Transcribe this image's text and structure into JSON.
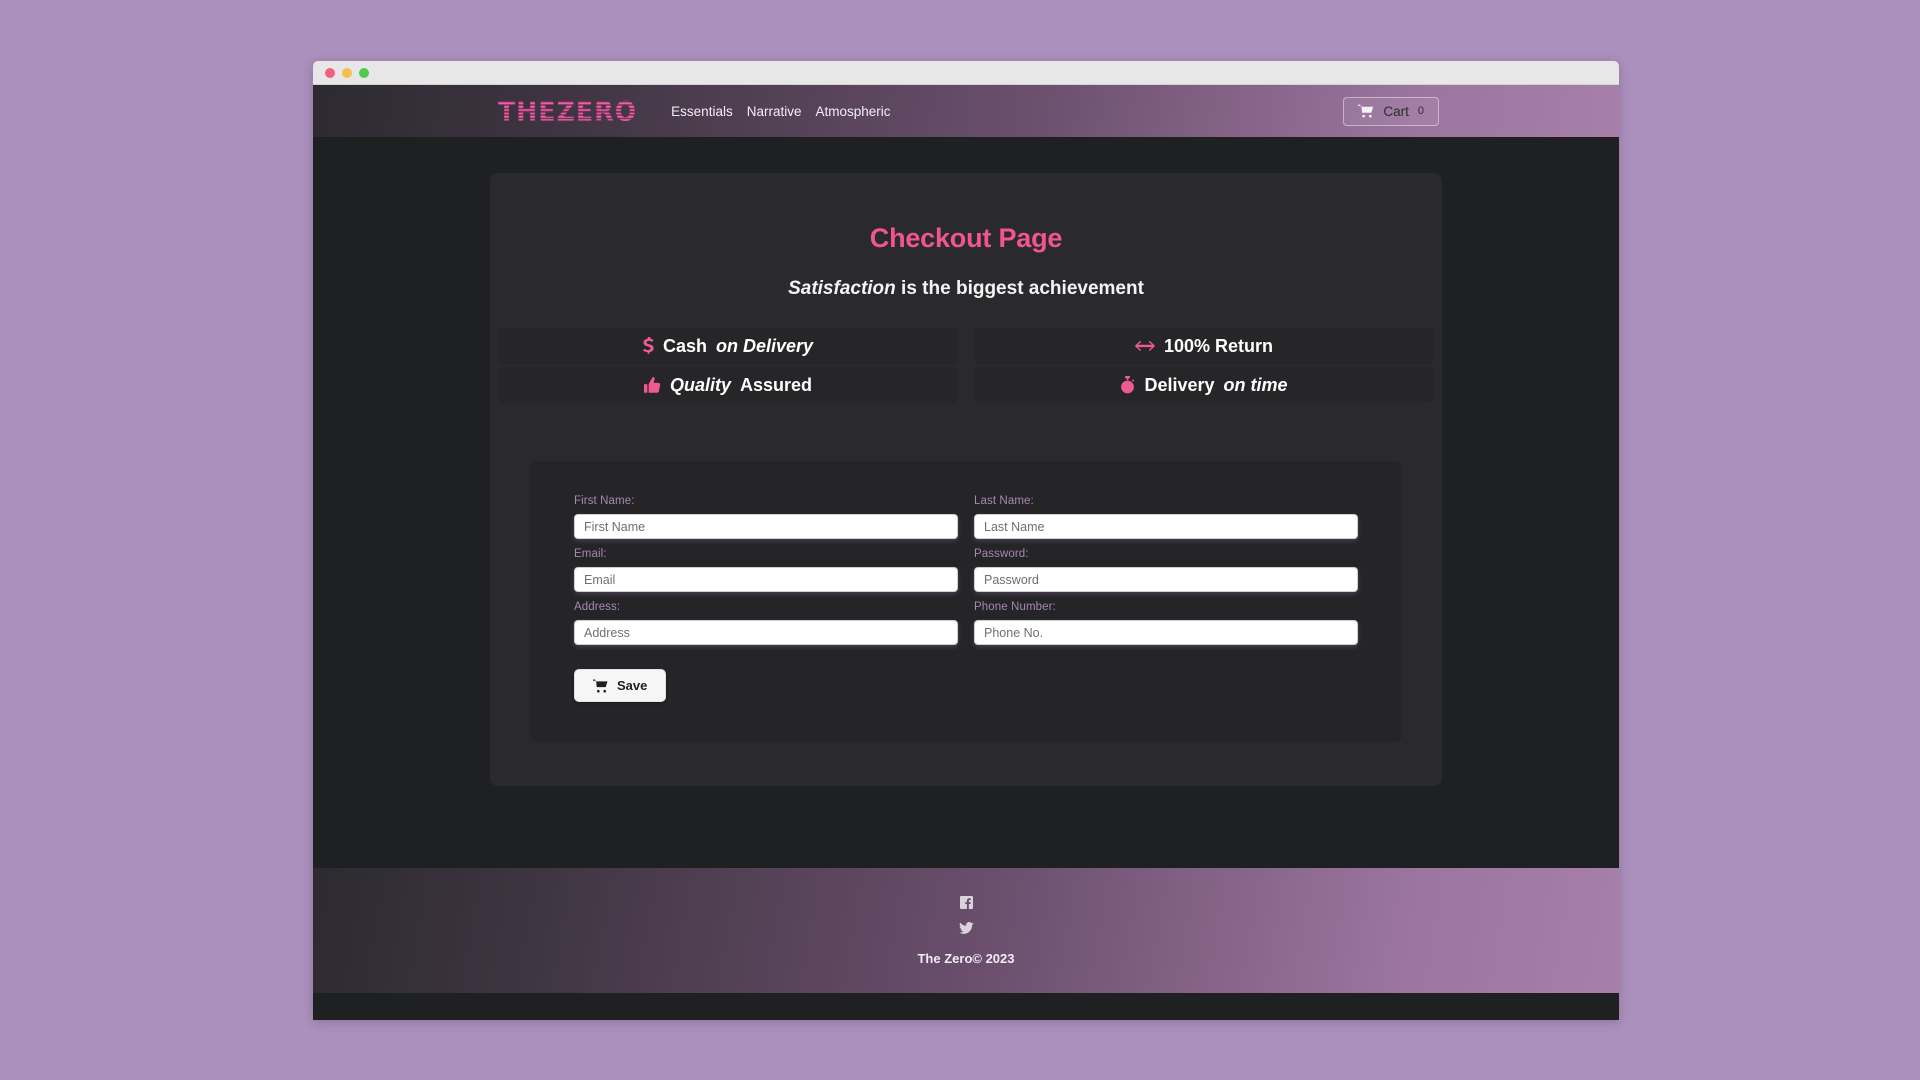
{
  "window": {
    "traffic_lights": [
      "close",
      "minimize",
      "maximize"
    ]
  },
  "navbar": {
    "brand": "THEZERO",
    "links": [
      {
        "label": "Essentials"
      },
      {
        "label": "Narrative"
      },
      {
        "label": "Atmospheric"
      }
    ],
    "cart": {
      "icon": "shopping-cart-icon",
      "label": "Cart",
      "count": "0"
    }
  },
  "main": {
    "title": "Checkout Page",
    "subtitle_emphasis": "Satisfaction",
    "subtitle_rest": " is the biggest achievement",
    "features": [
      {
        "icon": "dollar-sign-icon",
        "text_bold": "Cash",
        "text_em": "on Delivery"
      },
      {
        "icon": "arrows-left-right-icon",
        "text_bold": "100% Return",
        "text_em": ""
      },
      {
        "icon": "thumbs-up-icon",
        "text_bold": "Assured",
        "text_em": "Quality",
        "em_first": true
      },
      {
        "icon": "stopwatch-icon",
        "text_bold": "Delivery",
        "text_em": "on time"
      }
    ]
  },
  "form": {
    "fields": [
      {
        "label": "First Name:",
        "placeholder": "First Name",
        "value": "",
        "type": "text",
        "name": "first-name"
      },
      {
        "label": "Last Name:",
        "placeholder": "Last Name",
        "value": "",
        "type": "text",
        "name": "last-name"
      },
      {
        "label": "Email:",
        "placeholder": "Email",
        "value": "",
        "type": "text",
        "name": "email"
      },
      {
        "label": "Password:",
        "placeholder": "Password",
        "value": "",
        "type": "password",
        "name": "password"
      },
      {
        "label": "Address:",
        "placeholder": "Address",
        "value": "",
        "type": "text",
        "name": "address"
      },
      {
        "label": "Phone Number:",
        "placeholder": "Phone No.",
        "value": "",
        "type": "text",
        "name": "phone-number"
      }
    ],
    "save": {
      "icon": "cart-plus-icon",
      "label": "Save"
    }
  },
  "footer": {
    "social": [
      {
        "icon": "facebook-icon",
        "name": "facebook"
      },
      {
        "icon": "twitter-icon",
        "name": "twitter"
      }
    ],
    "copyright": "The Zero© 2023"
  },
  "colors": {
    "page_background": "#ab8fbc",
    "viewport_background": "#1f2022",
    "card_background": "#2a2a2d",
    "form_background": "#252527",
    "accent_pink": "#f0558f",
    "label_purple": "#a886b5",
    "navbar_gradient_start": "#2c2a30",
    "navbar_gradient_end": "#a77fa8"
  }
}
